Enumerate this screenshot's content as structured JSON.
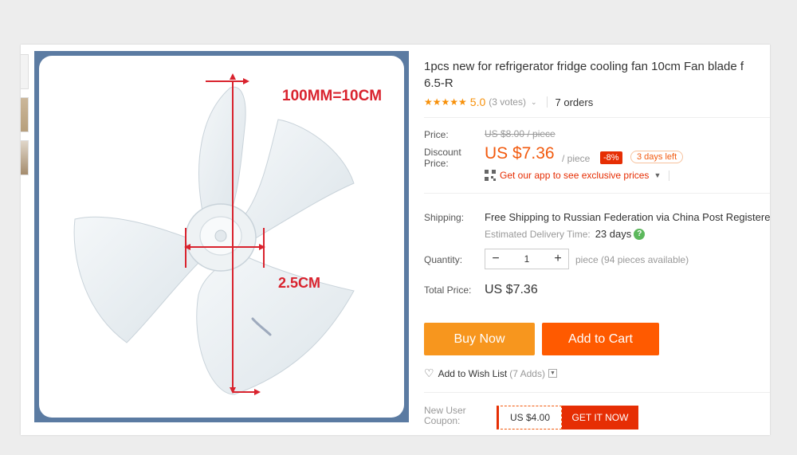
{
  "product": {
    "title_line1": "1pcs new for refrigerator fridge cooling fan 10cm Fan blade f",
    "title_line2": "6.5-R",
    "image_labels": {
      "diameter": "100MM=10CM",
      "hub": "2.5CM"
    }
  },
  "rating": {
    "stars": "★★★★★",
    "value": "5.0",
    "votes": "(3 votes)",
    "orders": "7 orders"
  },
  "pricing": {
    "price_label": "Price:",
    "original_price": "US $8.00 / piece",
    "discount_label_line1": "Discount",
    "discount_label_line2": "Price:",
    "discount_price": "US $7.36",
    "per_piece": "/ piece",
    "discount_pct": "-8%",
    "days_left": "3 days left",
    "app_promo": "Get our app to see exclusive prices"
  },
  "shipping": {
    "label": "Shipping:",
    "free_text": "Free Shipping to",
    "destination": "Russian Federation via China Post Registered",
    "estimate_label": "Estimated Delivery Time:",
    "estimate_days": "23 days"
  },
  "quantity": {
    "label": "Quantity:",
    "value": "1",
    "note": "piece (94 pieces available)"
  },
  "total": {
    "label": "Total Price:",
    "value": "US $7.36"
  },
  "actions": {
    "buy_now": "Buy Now",
    "add_to_cart": "Add to Cart",
    "wishlist": "Add to Wish List",
    "wishlist_count": "(7 Adds)"
  },
  "coupon": {
    "label_line1": "New User",
    "label_line2": "Coupon:",
    "amount": "US $4.00",
    "cta": "GET IT NOW"
  },
  "colors": {
    "accent_orange": "#f25a0e",
    "buy_now": "#f7961e",
    "add_to_cart": "#ff5a00",
    "star": "#f79009",
    "image_frame": "#5b7ba2"
  }
}
